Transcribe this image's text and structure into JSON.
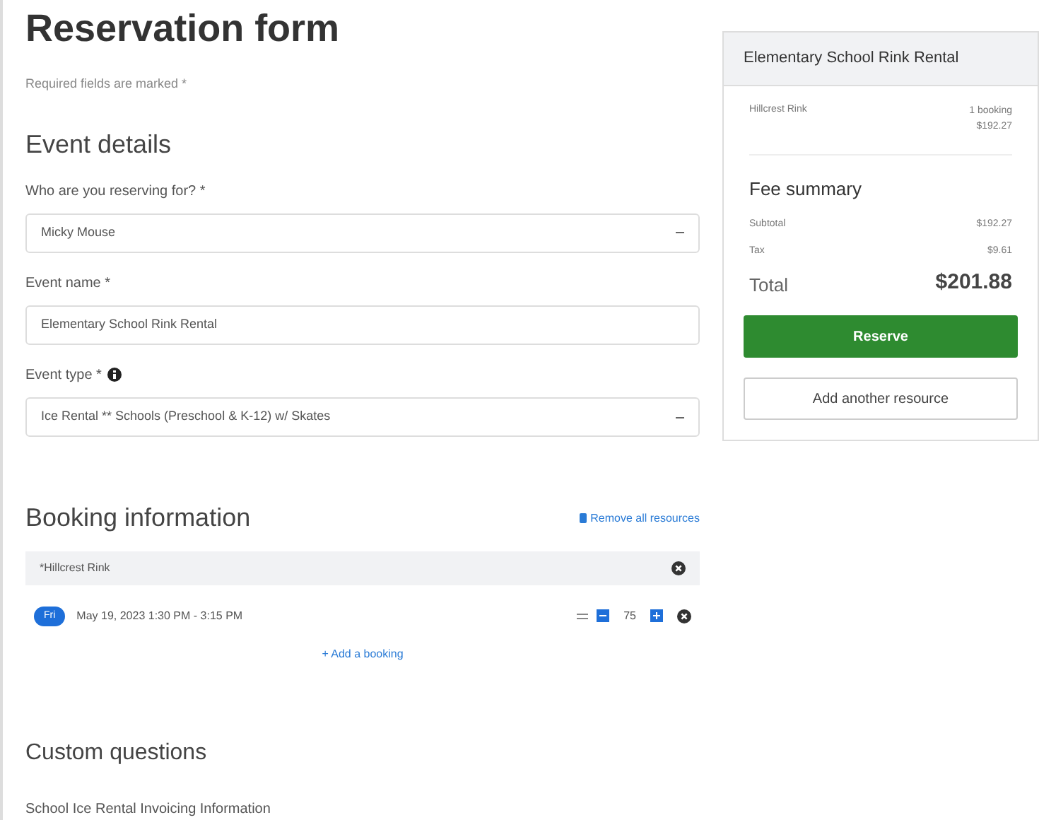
{
  "title": "Reservation form",
  "required_note": "Required fields are marked *",
  "event_details": {
    "heading": "Event details",
    "fields": [
      {
        "kind": "select",
        "label": "Who are you reserving for? *",
        "value": "Micky Mouse",
        "info": false
      },
      {
        "kind": "text",
        "label": "Event name *",
        "value": "Elementary School Rink Rental",
        "info": false
      },
      {
        "kind": "select",
        "label": "Event type *",
        "value": "Ice Rental ** Schools (Preschool & K-12) w/ Skates",
        "info": true
      }
    ]
  },
  "booking": {
    "heading": "Booking information",
    "remove_link": "Remove all resources",
    "resources": [
      {
        "name": "*Hillcrest Rink",
        "bookings": [
          {
            "day": "Fri",
            "time": "May 19, 2023 1:30 PM - 3:15 PM",
            "count": "75"
          }
        ]
      }
    ],
    "add_link": "+ Add a booking"
  },
  "custom_questions": {
    "heading": "Custom questions",
    "subheading": "School Ice Rental Invoicing Information"
  },
  "summary": {
    "title": "Elementary School Rink Rental",
    "items": [
      {
        "name": "Hillcrest Rink",
        "bookings": "1 booking",
        "price": "$192.27"
      }
    ],
    "fee_heading": "Fee summary",
    "fees": [
      {
        "label": "Subtotal",
        "value": "$192.27"
      },
      {
        "label": "Tax",
        "value": "$9.61"
      }
    ],
    "total_label": "Total",
    "total_value": "$201.88",
    "reserve_button": "Reserve",
    "add_button": "Add another resource"
  }
}
